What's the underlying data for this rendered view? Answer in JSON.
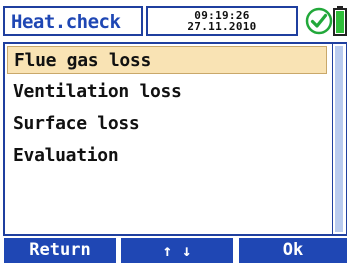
{
  "header": {
    "title": "Heat.check",
    "time": "09:19:26",
    "date": "27.11.2010",
    "status_icon": "check-circle-icon",
    "battery_icon": "battery-icon"
  },
  "menu": {
    "items": [
      {
        "label": "Flue gas loss",
        "selected": true
      },
      {
        "label": "Ventilation loss",
        "selected": false
      },
      {
        "label": "Surface loss",
        "selected": false
      },
      {
        "label": "Evaluation",
        "selected": false
      }
    ]
  },
  "softkeys": {
    "left": "Return",
    "middle": "↑ ↓",
    "right": "Ok"
  },
  "colors": {
    "accent_blue": "#1f47b4",
    "frame_blue": "#1f3f9f",
    "selection_bg": "#f9e3b4",
    "status_green": "#22a83a"
  }
}
